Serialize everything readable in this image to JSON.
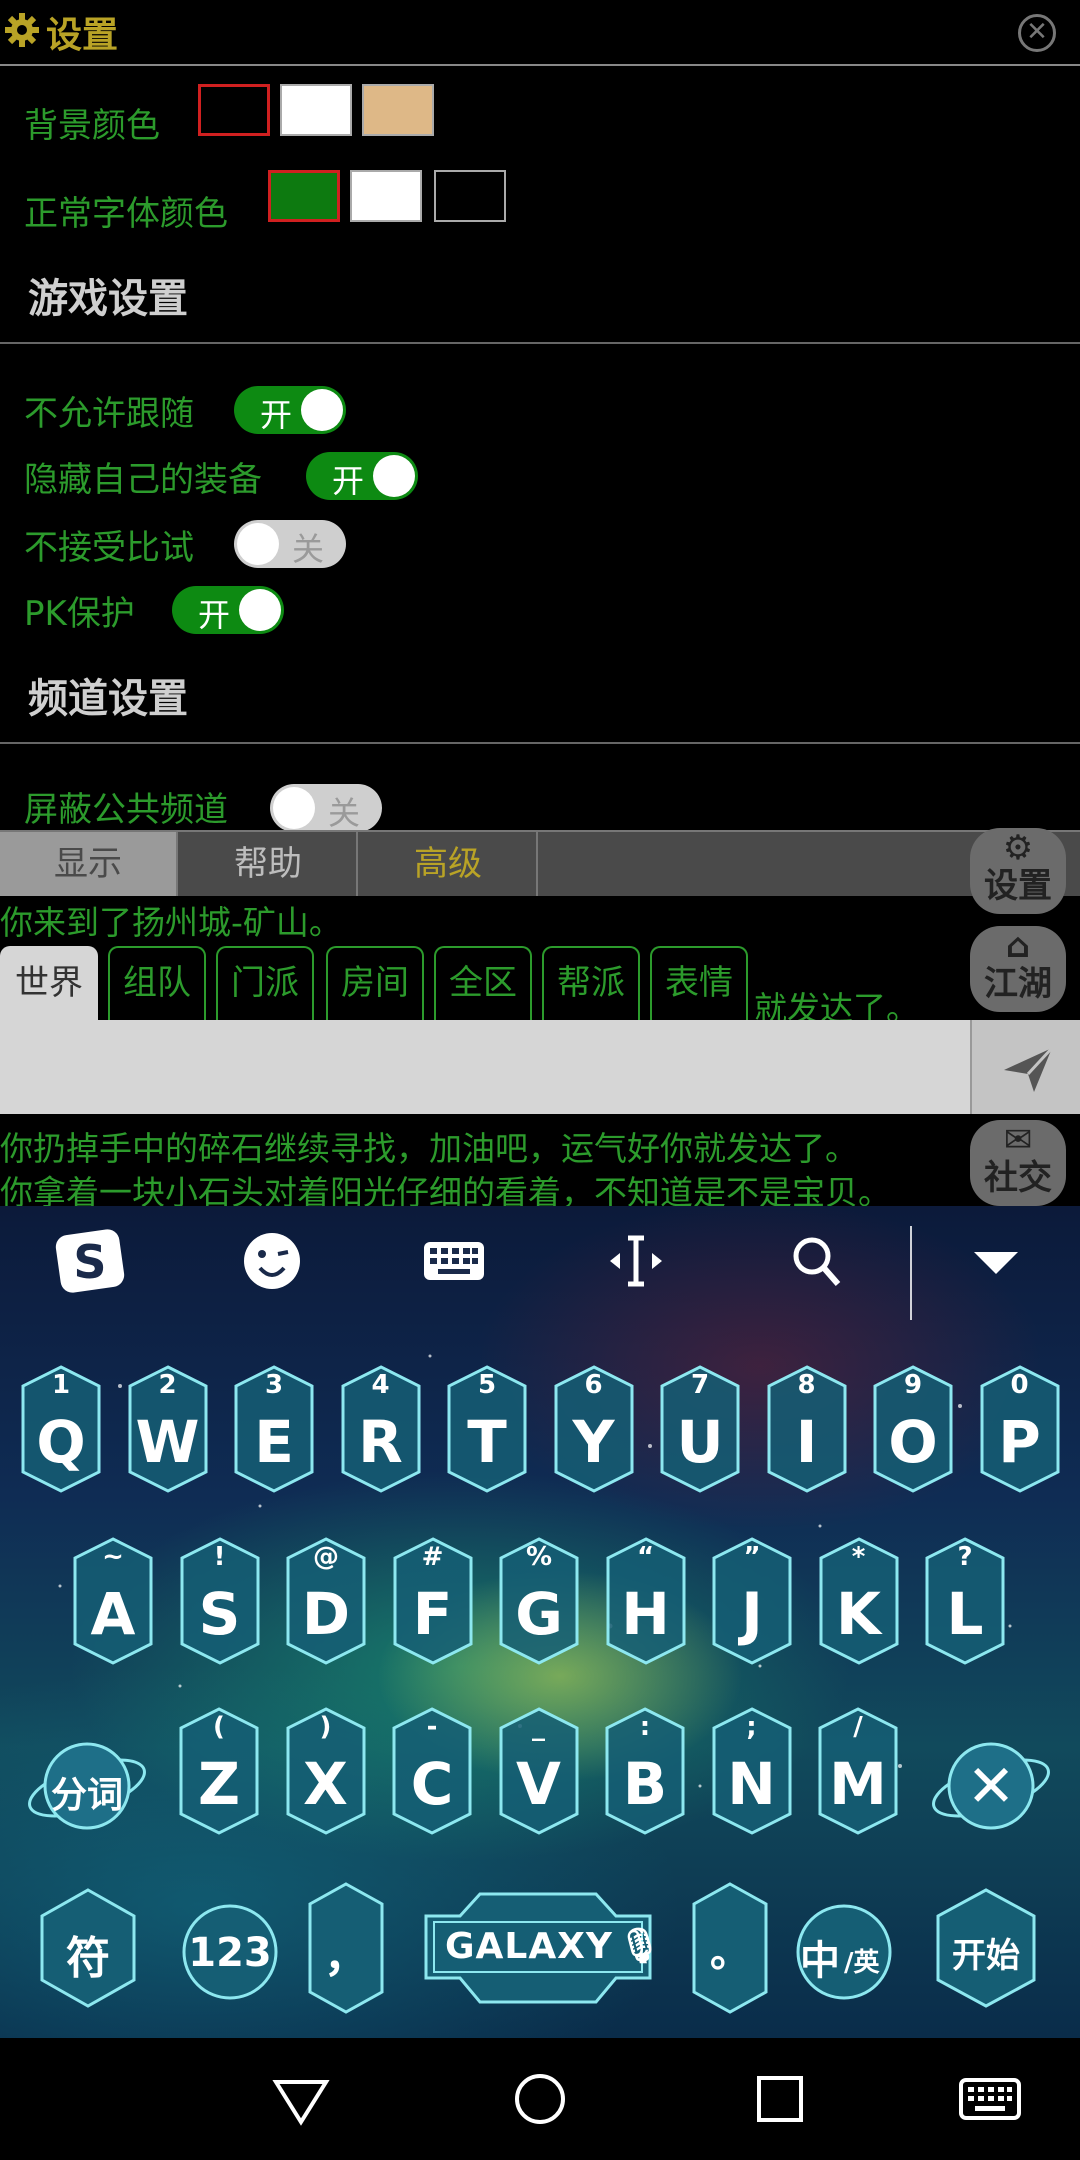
{
  "settings": {
    "title": "设置",
    "background_color_label": "背景颜色",
    "font_color_label": "正常字体颜色",
    "background_swatches": [
      "#000000",
      "#ffffff",
      "#deb887"
    ],
    "font_swatches": [
      "#0d7a10",
      "#ffffff",
      "#000000"
    ],
    "game_section": "游戏设置",
    "channel_section": "频道设置",
    "toggles": [
      {
        "label": "不允许跟随",
        "state": "开"
      },
      {
        "label": "隐藏自己的装备",
        "state": "开"
      },
      {
        "label": "不接受比试",
        "state": "关"
      },
      {
        "label": "PK保护",
        "state": "开"
      },
      {
        "label": "屏蔽公共频道",
        "state": "关"
      }
    ]
  },
  "tabs": {
    "display": "显示",
    "help": "帮助",
    "advanced": "高级"
  },
  "side_buttons": {
    "settings": "设置",
    "jianghu": "江湖",
    "social": "社交"
  },
  "chat": {
    "message_1": "你来到了扬州城-矿山。",
    "message_partial": "就发达了。",
    "message_2": "你扔掉手中的碎石继续寻找，加油吧，运气好你就发达了。",
    "message_3": "你拿着一块小石头对着阳光仔细的看着，不知道是不是宝贝。",
    "input_value": ""
  },
  "channels": [
    "世界",
    "组队",
    "门派",
    "房间",
    "全区",
    "帮派",
    "表情"
  ],
  "keyboard": {
    "row1": [
      {
        "letter": "Q",
        "sub": "1"
      },
      {
        "letter": "W",
        "sub": "2"
      },
      {
        "letter": "E",
        "sub": "3"
      },
      {
        "letter": "R",
        "sub": "4"
      },
      {
        "letter": "T",
        "sub": "5"
      },
      {
        "letter": "Y",
        "sub": "6"
      },
      {
        "letter": "U",
        "sub": "7"
      },
      {
        "letter": "I",
        "sub": "8"
      },
      {
        "letter": "O",
        "sub": "9"
      },
      {
        "letter": "P",
        "sub": "0"
      }
    ],
    "row2": [
      {
        "letter": "A",
        "sub": "~"
      },
      {
        "letter": "S",
        "sub": "!"
      },
      {
        "letter": "D",
        "sub": "@"
      },
      {
        "letter": "F",
        "sub": "#"
      },
      {
        "letter": "G",
        "sub": "%"
      },
      {
        "letter": "H",
        "sub": "“"
      },
      {
        "letter": "J",
        "sub": "”"
      },
      {
        "letter": "K",
        "sub": "*"
      },
      {
        "letter": "L",
        "sub": "?"
      }
    ],
    "row3": [
      {
        "letter": "Z",
        "sub": "("
      },
      {
        "letter": "X",
        "sub": ")"
      },
      {
        "letter": "C",
        "sub": "-"
      },
      {
        "letter": "V",
        "sub": "_"
      },
      {
        "letter": "B",
        "sub": ":"
      },
      {
        "letter": "N",
        "sub": ";"
      },
      {
        "letter": "M",
        "sub": "/"
      }
    ],
    "segment_key": "分词",
    "delete_key": "✕",
    "symbol_key": "符",
    "number_key": "123",
    "comma_key": "，",
    "space_key": "GALAXY",
    "period_key": "。",
    "lang_key_main": "中",
    "lang_key_sub": "/英",
    "start_key": "开始"
  }
}
